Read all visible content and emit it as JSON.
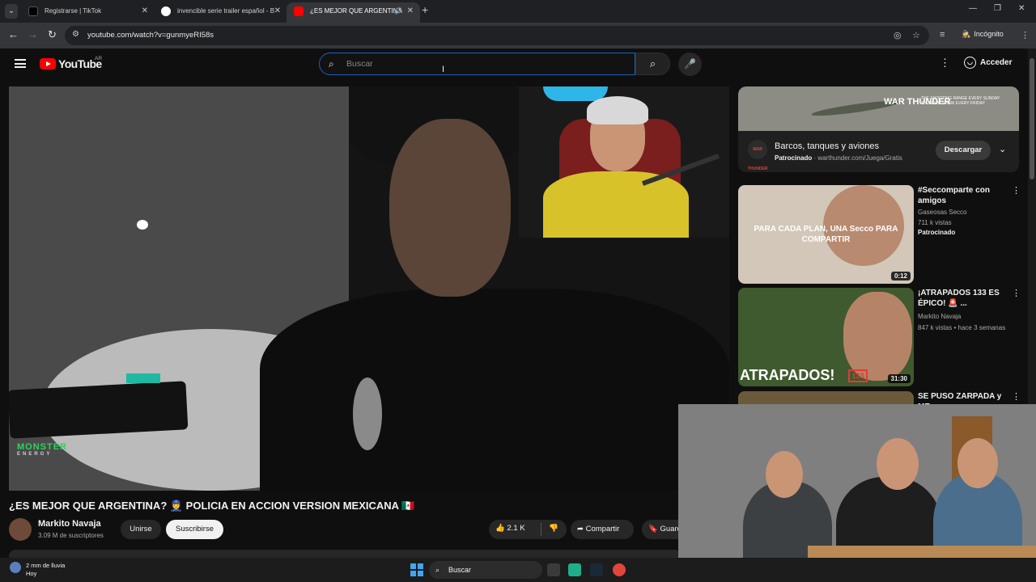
{
  "browser": {
    "tabs": [
      {
        "title": "Registrarse | TikTok",
        "favicon": "tiktok-icon",
        "active": false
      },
      {
        "title": "invencible serie trailer español - B",
        "favicon": "google-icon",
        "active": false
      },
      {
        "title": "¿ES MEJOR QUE ARGENTINA",
        "favicon": "youtube-icon",
        "active": true
      }
    ],
    "url": "youtube.com/watch?v=gunmyeRI58s",
    "profile_label": "Incógnito"
  },
  "youtube": {
    "logo_text": "YouTube",
    "country_code": "AR",
    "search_placeholder": "Buscar",
    "signin_label": "Acceder"
  },
  "video": {
    "title": "¿ES MEJOR QUE ARGENTINA? 👮 POLICIA EN ACCION VERSION MEXICANA 🇲🇽",
    "channel_name": "Markito Navaja",
    "subscribers": "3.09 M de suscriptores",
    "join_label": "Unirse",
    "subscribe_label": "Suscribirse",
    "likes": "2.1 K",
    "share_label": "Compartir",
    "save_label": "Guardar",
    "overlay_brand": "MONSTER",
    "overlay_brand_sub": "ENERGY"
  },
  "ad": {
    "banner_logo": "WAR THUNDER",
    "banner_small": "THE SHOOTING RANGE EVERY SUNDAY THUNDER SHOW EVERY FRIDAY",
    "icon_text": "WAR THUNDER",
    "title": "Barcos, tanques y aviones",
    "sponsored_label": "Patrocinado",
    "domain": "warthunder.com/Juega/Gratis",
    "cta_label": "Descargar"
  },
  "recommendations": [
    {
      "title": "#Seccomparte con amigos",
      "channel": "Gaseosas Secco",
      "views": "711 k vistas",
      "age": "",
      "sponsored": "Patrocinado",
      "duration": "0:12",
      "thumb_text": "PARA CADA PLAN, UNA Secco PARA COMPARTIR"
    },
    {
      "title": "¡ATRAPADOS 133 ES ÉPICO! 🚨 ...",
      "channel": "Markito Navaja",
      "views": "847 k vistas",
      "age": "hace 3 semanas",
      "sponsored": "",
      "duration": "31:30",
      "thumb_text": "ATRAPADOS!",
      "thumb_num": "133"
    },
    {
      "title": "SE PUSO ZARPADA y ME",
      "channel": "",
      "views": "",
      "age": "",
      "sponsored": "",
      "duration": "",
      "thumb_text": ""
    }
  ],
  "taskbar": {
    "weather_line1": "2 mm de lluvia",
    "weather_line2": "Hoy",
    "search_label": "Buscar"
  },
  "colors": {
    "youtube_red": "#ff0000",
    "background": "#0f0f0f",
    "search_focus": "#1c62b9"
  }
}
